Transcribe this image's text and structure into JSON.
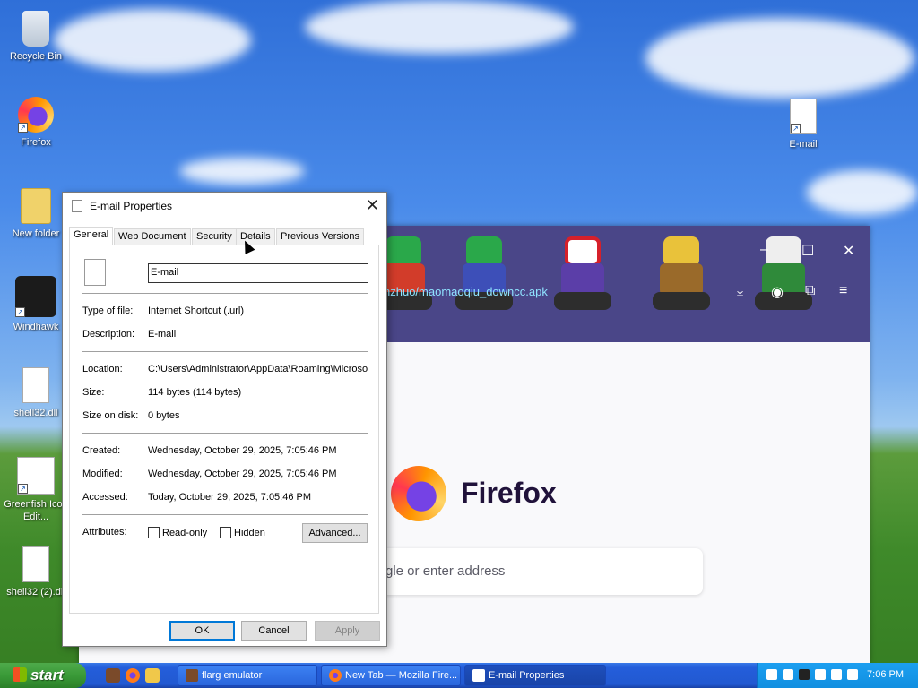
{
  "desktop": {
    "icons": [
      {
        "label": "Recycle Bin",
        "icon": "recycle-bin-icon"
      },
      {
        "label": "Firefox",
        "icon": "firefox-icon"
      },
      {
        "label": "New folder",
        "icon": "folder-icon"
      },
      {
        "label": "Windhawk",
        "icon": "windhawk-icon"
      },
      {
        "label": "shell32.dll",
        "icon": "dll-file-icon"
      },
      {
        "label": "Greenfish Icon Edit...",
        "icon": "greenfish-icon"
      },
      {
        "label": "shell32 (2).dll",
        "icon": "dll-file-icon"
      },
      {
        "label": "E-mail",
        "icon": "internet-shortcut-icon"
      }
    ]
  },
  "firefox": {
    "url_fragment": "nzhuo/maomaoqiu_downcc.apk",
    "brand": "Firefox",
    "search_placeholder": "gle or enter address"
  },
  "dialog": {
    "title": "E-mail Properties",
    "tabs": [
      "General",
      "Web Document",
      "Security",
      "Details",
      "Previous Versions"
    ],
    "active_tab": "General",
    "file_name": "E-mail",
    "fields": {
      "type_label": "Type of file:",
      "type_value": "Internet Shortcut (.url)",
      "desc_label": "Description:",
      "desc_value": "E-mail",
      "location_label": "Location:",
      "location_value": "C:\\Users\\Administrator\\AppData\\Roaming\\Microsof",
      "size_label": "Size:",
      "size_value": "114 bytes (114 bytes)",
      "disk_label": "Size on disk:",
      "disk_value": "0 bytes",
      "created_label": "Created:",
      "created_value": "Wednesday, October 29, 2025, 7:05:46 PM",
      "modified_label": "Modified:",
      "modified_value": "Wednesday, October 29, 2025, 7:05:46 PM",
      "accessed_label": "Accessed:",
      "accessed_value": "Today, October 29, 2025, 7:05:46 PM",
      "attributes_label": "Attributes:",
      "readonly_label": "Read-only",
      "hidden_label": "Hidden",
      "readonly_checked": false,
      "hidden_checked": false
    },
    "buttons": {
      "advanced": "Advanced...",
      "ok": "OK",
      "cancel": "Cancel",
      "apply": "Apply"
    }
  },
  "taskbar": {
    "start_label": "start",
    "tasks": [
      {
        "label": "flarg emulator",
        "active": false
      },
      {
        "label": "New Tab — Mozilla Fire...",
        "active": false
      },
      {
        "label": "E-mail Properties",
        "active": true
      }
    ],
    "clock": "7:06 PM"
  },
  "colors": {
    "accent": "#0078d7",
    "taskbar": "#245edb",
    "start": "#3a9a38",
    "firefox_header": "#4a4688"
  }
}
